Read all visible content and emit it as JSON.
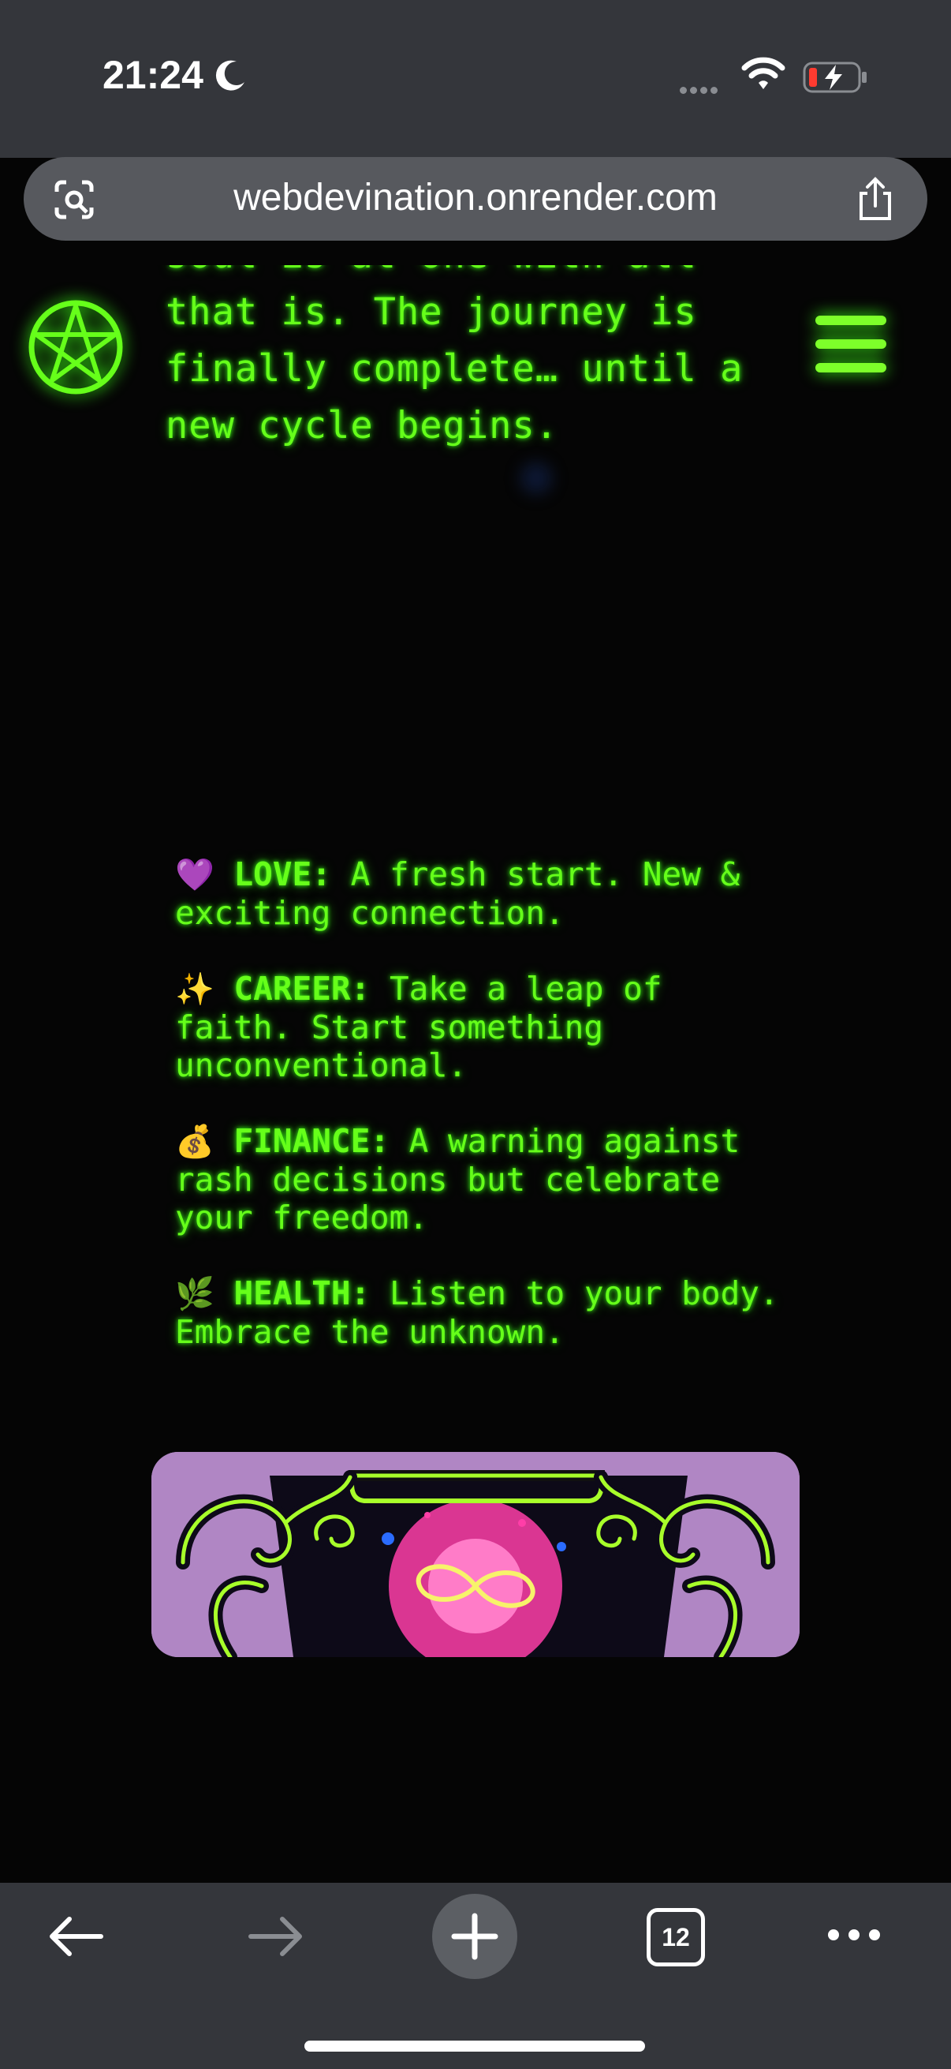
{
  "status_bar": {
    "time": "21:24",
    "icons": [
      "moon-icon",
      "signal-icon",
      "wifi-icon",
      "battery-charging-icon"
    ]
  },
  "browser": {
    "url": "webdevination.onrender.com",
    "tab_count": "12",
    "icons": [
      "lens-icon",
      "share-icon",
      "back-icon",
      "forward-icon",
      "new-tab-icon",
      "more-icon"
    ]
  },
  "page": {
    "intro_lines": [
      "soul  is  at  one  with  all",
      "that  is.  The  journey  is",
      "finally  complete…  until  a",
      "new cycle begins."
    ],
    "readings": [
      {
        "emoji": "💜",
        "label": "LOVE:",
        "text": " A fresh start. New & exciting connection."
      },
      {
        "emoji": "✨",
        "label": "CAREER:",
        "text": " Take a leap of faith. Start something unconventional."
      },
      {
        "emoji": "💰",
        "label": "FINANCE:",
        "text": " A warning against rash decisions but celebrate your freedom."
      },
      {
        "emoji": "🌿",
        "label": "HEALTH:",
        "text": " Listen to your body. Embrace the unknown."
      }
    ],
    "colors": {
      "neon_green": "#66ff1a",
      "background": "#050505",
      "card_bg": "#b086c4"
    }
  }
}
